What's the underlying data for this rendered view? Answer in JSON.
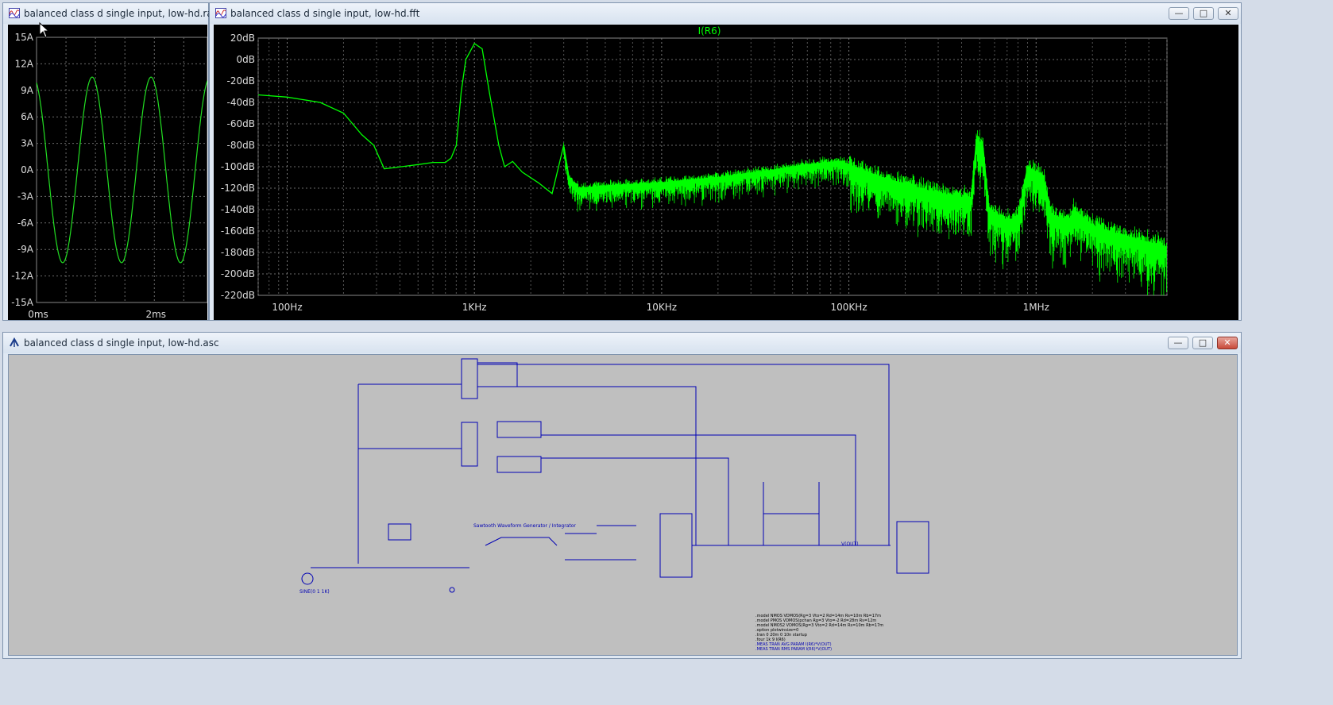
{
  "raw_window": {
    "title": "balanced class d single input, low-hd.raw",
    "icon": "waveform-icon"
  },
  "fft_window": {
    "title": "balanced class d single input, low-hd.fft",
    "icon": "waveform-icon",
    "trace_label": "I(R6)",
    "buttons": {
      "minimize": "—",
      "maximize": "□",
      "close": "✕"
    }
  },
  "asc_window": {
    "title": "balanced class d single input, low-hd.asc",
    "icon": "schematic-icon",
    "buttons": {
      "minimize": "—",
      "maximize": "□",
      "close": "✕"
    },
    "source_label": "SINE(0 1 1K)",
    "comment_label": "Sawtooth Waveform Generator / Integrator",
    "directives": [
      ".model NMOS VDMOS(Rg=3 Vto=2 Rd=14m Rs=10m Rb=17m",
      ".model PMOS VDMOS(pchan Rg=3 Vto=-2 Rd=28m Rs=12m",
      ".model NMOS2 VDMOS(Rg=3 Vto=2 Rd=14m Rs=10m Rb=17m",
      ".option plotwinsize=0",
      ".tran 0 20m 0 10n startup",
      ".four 1k 9 I(R6)",
      ".MEAS TRAN AVG PARAM I(R6)*V(OUT)",
      ".MEAS TRAN RMS PARAM I(R6)*V(OUT)"
    ]
  },
  "colors": {
    "trace": "#00ff00",
    "schematic": "#0000b4",
    "plot_bg": "#000000",
    "schem_bg": "#bfbfbf"
  },
  "chart_data": [
    {
      "type": "line",
      "title": "",
      "xlabel": "",
      "ylabel": "",
      "x_unit": "ms",
      "y_unit": "A",
      "ylim": [
        -15,
        15
      ],
      "xlim": [
        0,
        2.9
      ],
      "yticks": [
        "15A",
        "12A",
        "9A",
        "6A",
        "3A",
        "0A",
        "-3A",
        "-6A",
        "-9A",
        "-12A",
        "-15A"
      ],
      "xticks": [
        "0ms",
        "2ms"
      ],
      "series": [
        {
          "amplitude": 10.5,
          "frequency_hz": 1000,
          "phase_deg": 90
        }
      ],
      "grid": true
    },
    {
      "type": "line",
      "title": "I(R6)",
      "xlabel": "",
      "ylabel": "",
      "x_scale": "log",
      "xlim": [
        70,
        5000000
      ],
      "ylim": [
        -220,
        20
      ],
      "yticks": [
        "20dB",
        "0dB",
        "-20dB",
        "-40dB",
        "-60dB",
        "-80dB",
        "-100dB",
        "-120dB",
        "-140dB",
        "-160dB",
        "-180dB",
        "-200dB",
        "-220dB"
      ],
      "xticks": [
        "100Hz",
        "1KHz",
        "10KHz",
        "100KHz",
        "1MHz"
      ],
      "series": [
        {
          "name": "I(R6)",
          "points": [
            [
              70,
              -33
            ],
            [
              100,
              -35
            ],
            [
              150,
              -40
            ],
            [
              200,
              -50
            ],
            [
              250,
              -70
            ],
            [
              290,
              -80
            ],
            [
              330,
              -102
            ],
            [
              500,
              -98
            ],
            [
              600,
              -96
            ],
            [
              700,
              -96
            ],
            [
              750,
              -92
            ],
            [
              800,
              -80
            ],
            [
              850,
              -30
            ],
            [
              900,
              0
            ],
            [
              1000,
              15
            ],
            [
              1100,
              10
            ],
            [
              1200,
              -30
            ],
            [
              1350,
              -80
            ],
            [
              1450,
              -100
            ],
            [
              1600,
              -95
            ],
            [
              1800,
              -105
            ],
            [
              2200,
              -115
            ],
            [
              2600,
              -125
            ],
            [
              3000,
              -80
            ],
            [
              3200,
              -110
            ],
            [
              3600,
              -120
            ],
            [
              5000,
              -118
            ],
            [
              10000,
              -115
            ],
            [
              20000,
              -110
            ],
            [
              40000,
              -103
            ],
            [
              60000,
              -98
            ],
            [
              90000,
              -95
            ],
            [
              150000,
              -110
            ],
            [
              300000,
              -125
            ],
            [
              450000,
              -130
            ],
            [
              480000,
              -75
            ],
            [
              520000,
              -80
            ],
            [
              560000,
              -140
            ],
            [
              700000,
              -150
            ],
            [
              800000,
              -148
            ],
            [
              900000,
              -100
            ],
            [
              1100000,
              -110
            ],
            [
              1200000,
              -145
            ],
            [
              1500000,
              -150
            ],
            [
              1600000,
              -140
            ],
            [
              2000000,
              -155
            ],
            [
              3000000,
              -165
            ],
            [
              5000000,
              -175
            ]
          ]
        }
      ],
      "grid": true
    }
  ]
}
